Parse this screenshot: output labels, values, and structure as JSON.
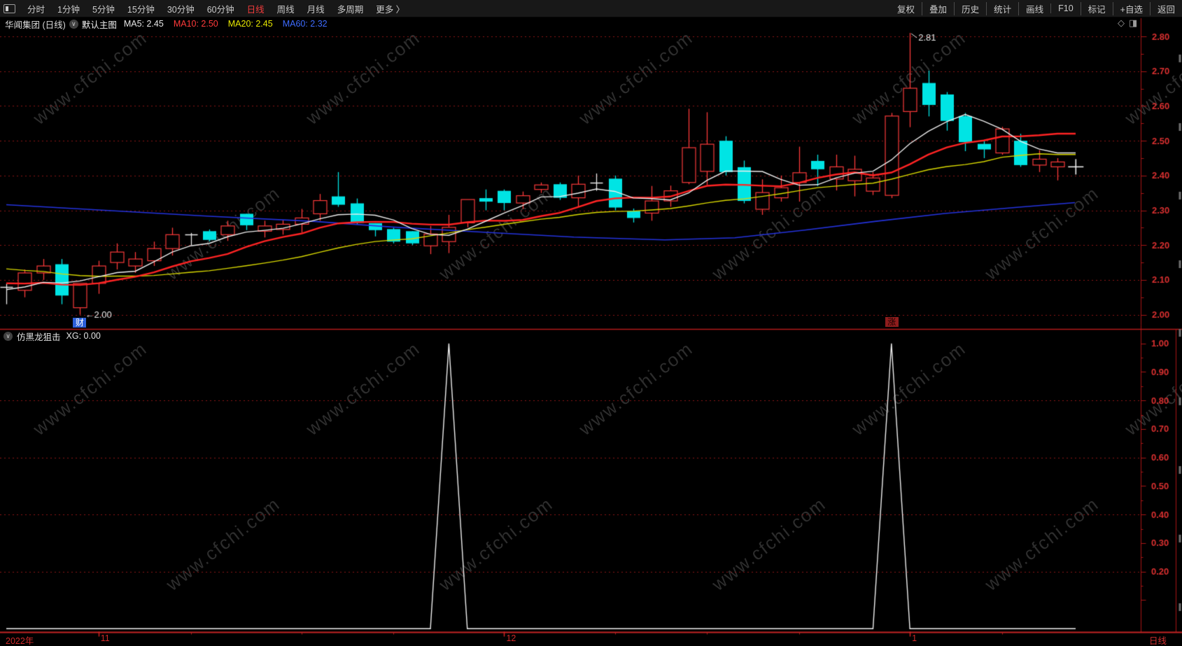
{
  "topbar": {
    "periods": [
      "分时",
      "1分钟",
      "5分钟",
      "15分钟",
      "30分钟",
      "60分钟",
      "日线",
      "周线",
      "月线",
      "多周期",
      "更多 〉"
    ],
    "active_period": "日线",
    "actions": [
      "复权",
      "叠加",
      "历史",
      "统计",
      "画线",
      "F10",
      "标记",
      "+自选",
      "返回"
    ]
  },
  "infobar": {
    "stock_title": "华闻集团 (日线)",
    "view_label": "默认主图",
    "ma_labels": [
      {
        "text": "MA5: 2.45",
        "color": "#e6e6e6"
      },
      {
        "text": "MA10: 2.50",
        "color": "#ff3a3a"
      },
      {
        "text": "MA20: 2.45",
        "color": "#e8e800"
      },
      {
        "text": "MA60: 2.32",
        "color": "#3d6bff"
      }
    ]
  },
  "icons": {
    "chevron_down": "∨",
    "diamond": "◇",
    "page": "◨"
  },
  "badges": {
    "finance": "财",
    "rise": "涨"
  },
  "indicator_panel": {
    "name": "仿黑龙狙击",
    "value_text": "XG: 0.00"
  },
  "time_axis": {
    "year_label": "2022年",
    "month_labels": [
      "11",
      "12",
      "1"
    ],
    "period_label": "日线"
  },
  "watermark_text": "www.cfchi.com",
  "chart_data": {
    "type": "candlestick",
    "title": "华闻集团 日线",
    "price_axis": {
      "min": 2.0,
      "max": 2.8,
      "tick": 0.1,
      "labels": [
        "2.80",
        "2.70",
        "2.60",
        "2.50",
        "2.40",
        "2.30",
        "2.20",
        "2.10",
        "2.00"
      ]
    },
    "signal_axis": {
      "min": 0.0,
      "max": 1.0,
      "labels": [
        "1.00",
        "0.90",
        "0.80",
        "0.70",
        "0.60",
        "0.50",
        "0.40",
        "0.30",
        "0.20"
      ],
      "grid_values": [
        0.8,
        0.6,
        0.4,
        0.2
      ]
    },
    "colors": {
      "up": "#fb3a3a",
      "down": "#00e4e4",
      "doji": "#e9e9e9",
      "ma5": "#eeeeee",
      "ma10": "#ff2424",
      "ma20": "#d9d900",
      "ma60": "#2433dd",
      "grid": "#8d1717",
      "axis": "#a81616",
      "divider": "#b51b1b",
      "time_axis": "#c32424",
      "label": "#da3030",
      "signal_line": "#f0f0f0",
      "annotation": "#e9e9e9"
    },
    "candles": [
      [
        2.08,
        2.09,
        2.03,
        2.08,
        1
      ],
      [
        2.07,
        2.13,
        2.05,
        2.12
      ],
      [
        2.12,
        2.16,
        2.1,
        2.14
      ],
      [
        2.145,
        2.16,
        2.03,
        2.055
      ],
      [
        2.02,
        2.09,
        2.0,
        2.09
      ],
      [
        2.09,
        2.155,
        2.06,
        2.14
      ],
      [
        2.15,
        2.205,
        2.13,
        2.18
      ],
      [
        2.14,
        2.18,
        2.12,
        2.16
      ],
      [
        2.155,
        2.21,
        2.14,
        2.19
      ],
      [
        2.19,
        2.25,
        2.17,
        2.23
      ],
      [
        2.23,
        2.235,
        2.2,
        2.23,
        1
      ],
      [
        2.24,
        2.245,
        2.21,
        2.215
      ],
      [
        2.23,
        2.27,
        2.212,
        2.255
      ],
      [
        2.29,
        2.29,
        2.243,
        2.257
      ],
      [
        2.24,
        2.27,
        2.222,
        2.255
      ],
      [
        2.245,
        2.272,
        2.23,
        2.26
      ],
      [
        2.26,
        2.304,
        2.236,
        2.278
      ],
      [
        2.29,
        2.347,
        2.27,
        2.328
      ],
      [
        2.34,
        2.41,
        2.31,
        2.316
      ],
      [
        2.32,
        2.334,
        2.26,
        2.264
      ],
      [
        2.263,
        2.263,
        2.225,
        2.243
      ],
      [
        2.246,
        2.25,
        2.205,
        2.21
      ],
      [
        2.24,
        2.24,
        2.2,
        2.205
      ],
      [
        2.198,
        2.255,
        2.174,
        2.232
      ],
      [
        2.21,
        2.287,
        2.177,
        2.251
      ],
      [
        2.264,
        2.331,
        2.251,
        2.331
      ],
      [
        2.335,
        2.36,
        2.3,
        2.325
      ],
      [
        2.356,
        2.36,
        2.3,
        2.321
      ],
      [
        2.321,
        2.354,
        2.304,
        2.342
      ],
      [
        2.36,
        2.38,
        2.35,
        2.373
      ],
      [
        2.375,
        2.38,
        2.33,
        2.336
      ],
      [
        2.336,
        2.4,
        2.31,
        2.375
      ],
      [
        2.38,
        2.406,
        2.356,
        2.38,
        1
      ],
      [
        2.391,
        2.4,
        2.3,
        2.308
      ],
      [
        2.298,
        2.305,
        2.265,
        2.278
      ],
      [
        2.292,
        2.37,
        2.27,
        2.327
      ],
      [
        2.327,
        2.371,
        2.31,
        2.356
      ],
      [
        2.38,
        2.592,
        2.375,
        2.48
      ],
      [
        2.412,
        2.582,
        2.373,
        2.49
      ],
      [
        2.5,
        2.513,
        2.4,
        2.41
      ],
      [
        2.424,
        2.443,
        2.32,
        2.327
      ],
      [
        2.303,
        2.389,
        2.287,
        2.351
      ],
      [
        2.336,
        2.4,
        2.325,
        2.365
      ],
      [
        2.38,
        2.483,
        2.325,
        2.408
      ],
      [
        2.442,
        2.46,
        2.37,
        2.418
      ],
      [
        2.39,
        2.46,
        2.357,
        2.425
      ],
      [
        2.385,
        2.457,
        2.34,
        2.418
      ],
      [
        2.355,
        2.41,
        2.344,
        2.393
      ],
      [
        2.343,
        2.58,
        2.335,
        2.571
      ],
      [
        2.584,
        2.81,
        2.539,
        2.651
      ],
      [
        2.666,
        2.702,
        2.57,
        2.603
      ],
      [
        2.633,
        2.64,
        2.529,
        2.557
      ],
      [
        2.571,
        2.58,
        2.47,
        2.496
      ],
      [
        2.491,
        2.5,
        2.45,
        2.475
      ],
      [
        2.465,
        2.54,
        2.46,
        2.534
      ],
      [
        2.5,
        2.52,
        2.425,
        2.43
      ],
      [
        2.43,
        2.473,
        2.41,
        2.447
      ],
      [
        2.425,
        2.45,
        2.386,
        2.439
      ]
    ],
    "signal_values": [
      0,
      0,
      0,
      0,
      0,
      0,
      0,
      0,
      0,
      0,
      0,
      0,
      0,
      0,
      0,
      0,
      0,
      0,
      0,
      0,
      0,
      0,
      0,
      0,
      1,
      0,
      0,
      0,
      0,
      0,
      0,
      0,
      0,
      0,
      0,
      0,
      0,
      0,
      0,
      0,
      0,
      0,
      0,
      0,
      0,
      0,
      0,
      0,
      1,
      0,
      0,
      0,
      0,
      0,
      0,
      0,
      0,
      0
    ],
    "ma_seed_closes": [
      2.22,
      2.21,
      2.2,
      2.196,
      2.187,
      2.178,
      2.17,
      2.161,
      2.152,
      2.143,
      2.135,
      2.126,
      2.117,
      2.108,
      2.1,
      2.09,
      2.082,
      2.073,
      2.065,
      2.06
    ],
    "ma60_points": [
      [
        9,
        2.316
      ],
      [
        150,
        2.3
      ],
      [
        300,
        2.283
      ],
      [
        450,
        2.268
      ],
      [
        560,
        2.252
      ],
      [
        700,
        2.236
      ],
      [
        820,
        2.223
      ],
      [
        950,
        2.215
      ],
      [
        1050,
        2.221
      ],
      [
        1150,
        2.243
      ],
      [
        1250,
        2.268
      ],
      [
        1350,
        2.291
      ],
      [
        1450,
        2.308
      ],
      [
        1536,
        2.322
      ]
    ],
    "months": [
      {
        "label": "11",
        "slot": 5
      },
      {
        "label": "12",
        "slot": 27
      },
      {
        "label": "1",
        "slot": 49
      }
    ],
    "minor_tick_slots": [
      10,
      16,
      21,
      33,
      38,
      43,
      54
    ],
    "badge_slots": {
      "finance": 4,
      "rise": 48
    },
    "annotations": {
      "low_label": "←2.00",
      "low_value": 2.0,
      "low_slot": 4,
      "high_label": "2.81",
      "high_value": 2.81,
      "high_slot": 49
    },
    "crosshair": {
      "slot": 58,
      "price": 2.425
    }
  }
}
